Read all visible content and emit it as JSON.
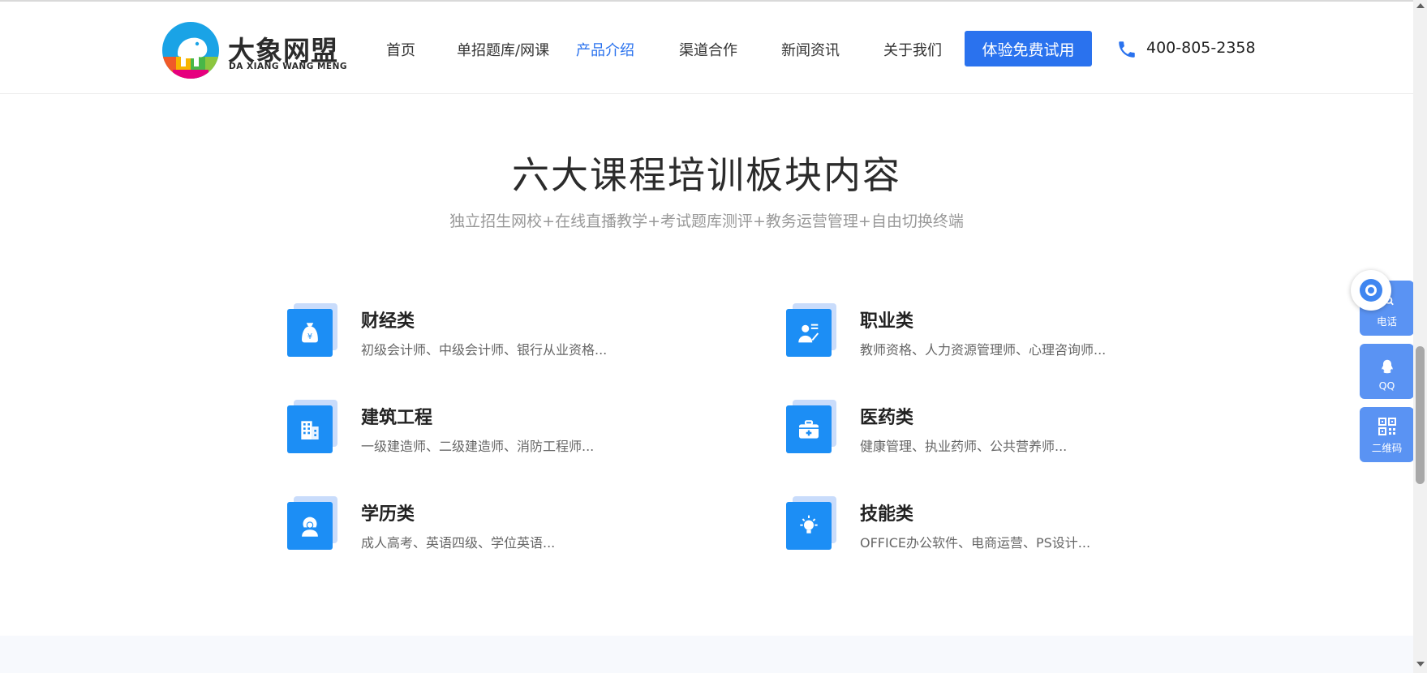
{
  "header": {
    "logo_cn": "大象网盟",
    "logo_en": "DA XIANG WANG MENG",
    "nav": [
      {
        "label": "首页",
        "active": false
      },
      {
        "label": "单招题库/网课",
        "active": false
      },
      {
        "label": "产品介绍",
        "active": true
      },
      {
        "label": "渠道合作",
        "active": false
      },
      {
        "label": "新闻资讯",
        "active": false
      },
      {
        "label": "关于我们",
        "active": false
      }
    ],
    "cta_label": "体验免费试用",
    "phone": "400-805-2358"
  },
  "section": {
    "title": "六大课程培训板块内容",
    "subtitle": "独立招生网校+在线直播教学+考试题库测评+教务运营管理+自由切换终端"
  },
  "courses": [
    {
      "title": "财经类",
      "desc": "初级会计师、中级会计师、银行从业资格...",
      "icon": "money-bag-icon"
    },
    {
      "title": "职业类",
      "desc": "教师资格、人力资源管理师、心理咨询师...",
      "icon": "teacher-icon"
    },
    {
      "title": "建筑工程",
      "desc": "一级建造师、二级建造师、消防工程师...",
      "icon": "building-icon"
    },
    {
      "title": "医药类",
      "desc": "健康管理、执业药师、公共营养师...",
      "icon": "medical-kit-icon"
    },
    {
      "title": "学历类",
      "desc": "成人高考、英语四级、学位英语...",
      "icon": "graduate-icon"
    },
    {
      "title": "技能类",
      "desc": "OFFICE办公软件、电商运营、PS设计...",
      "icon": "lightbulb-icon"
    }
  ],
  "side": {
    "phone_label": "电话",
    "qq_label": "QQ",
    "qr_label": "二维码"
  },
  "colors": {
    "accent": "#2a72ee",
    "icon_blue": "#1c8ef5",
    "side_blue": "#5a93f3"
  }
}
